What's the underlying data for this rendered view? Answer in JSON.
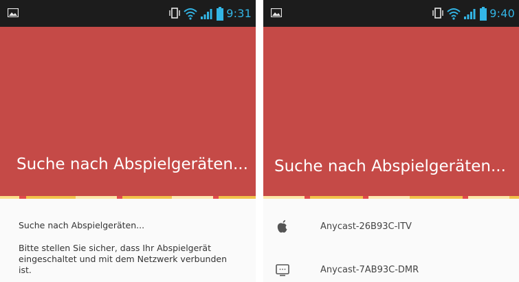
{
  "screens": [
    {
      "status": {
        "time": "9:31"
      },
      "header": {
        "title": "Suche nach Abspielgeräten..."
      },
      "content": {
        "status_message": "Suche nach Abspielgeräten...",
        "hint": "Bitte stellen Sie sicher, dass Ihr Abspielgerät eingeschaltet und mit dem Netzwerk verbunden ist."
      }
    },
    {
      "status": {
        "time": "9:40"
      },
      "header": {
        "title": "Suche nach Abspielgeräten..."
      },
      "devices": [
        {
          "name": "Anycast-26B93C-ITV",
          "icon": "apple-icon"
        },
        {
          "name": "Anycast-7AB93C-DMR",
          "icon": "tv-icon"
        }
      ]
    }
  ],
  "colors": {
    "header": "#c54a47",
    "statusbar": "#1c1c1c",
    "status_icons": "#33b5e5",
    "progress": "#f3c24a"
  }
}
